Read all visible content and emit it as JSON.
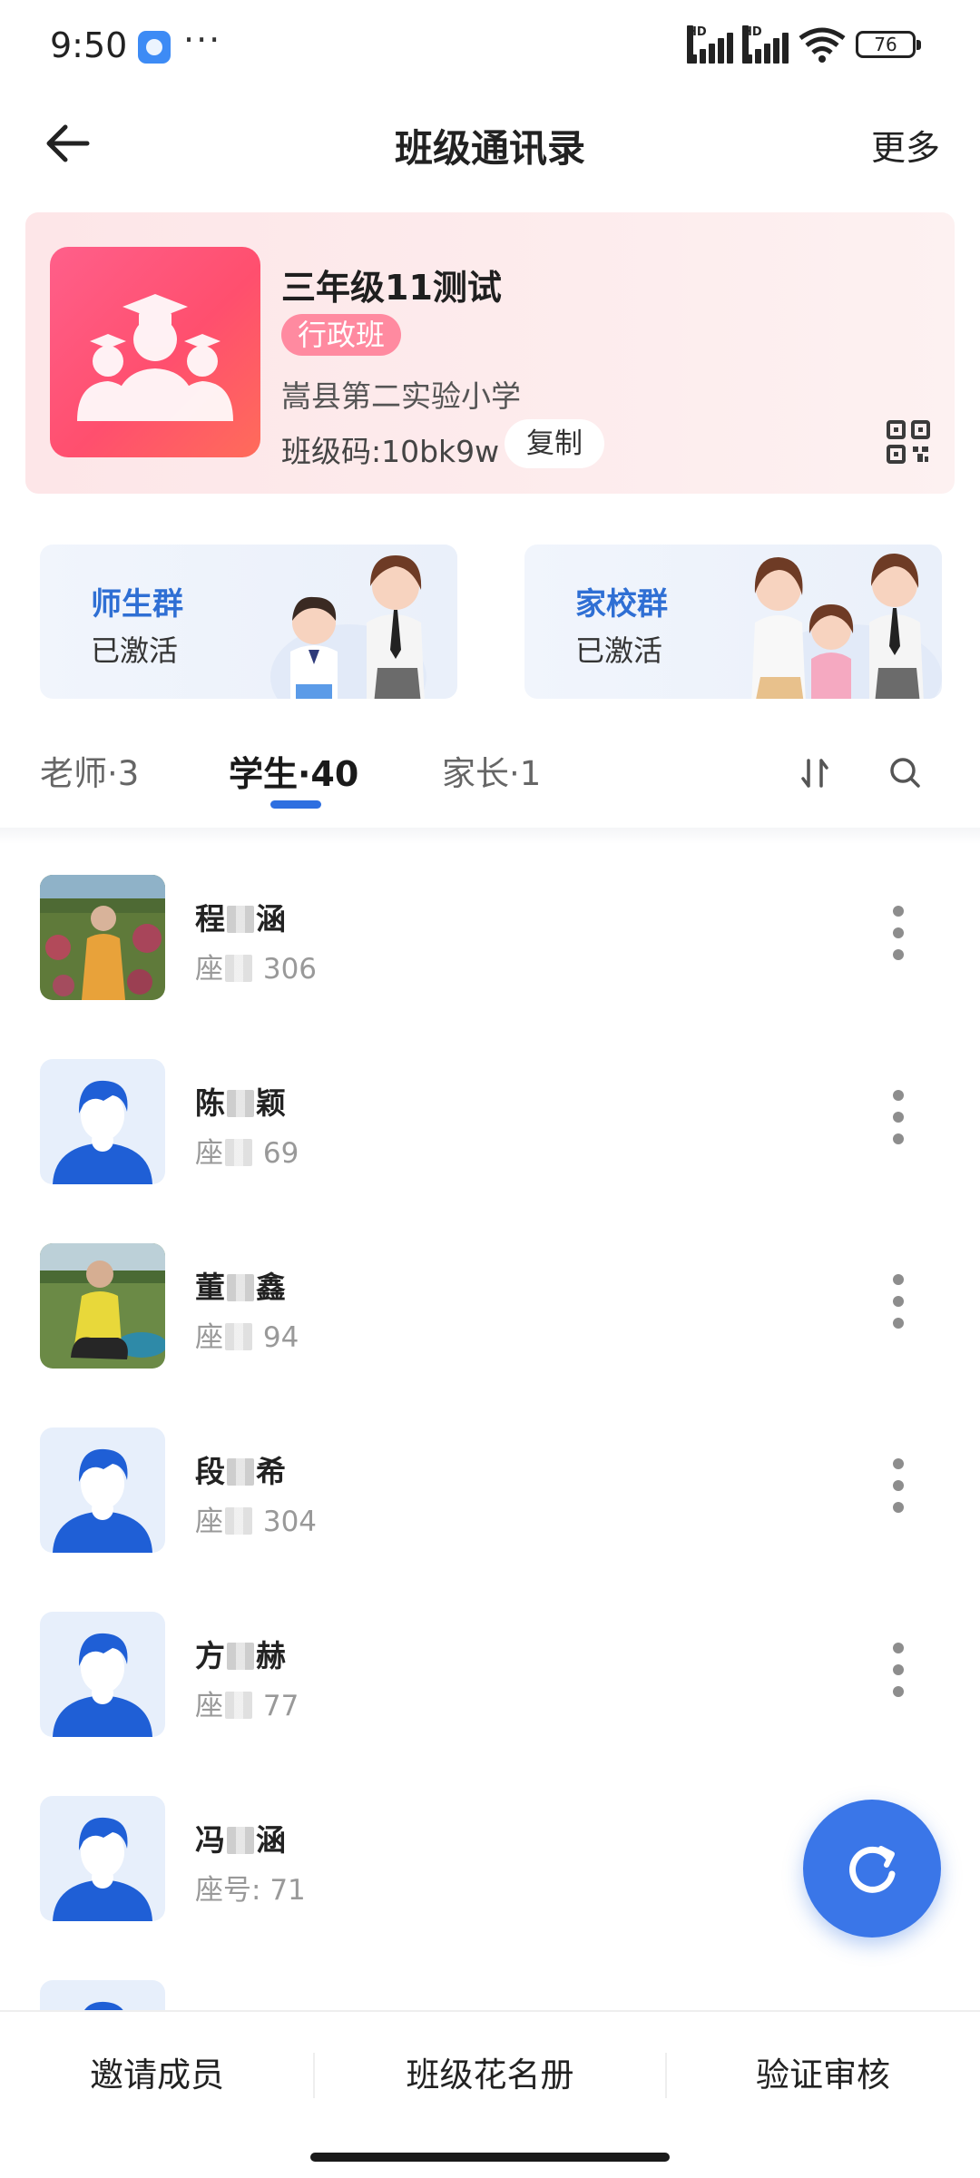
{
  "status_bar": {
    "time": "9:50",
    "more": "···",
    "signal_labels": [
      "HD",
      "HD"
    ],
    "battery": "76"
  },
  "header": {
    "title": "班级通讯录",
    "more": "更多"
  },
  "class_card": {
    "name": "三年级11测试",
    "tag": "行政班",
    "school": "嵩县第二实验小学",
    "code": "班级码:10bk9w",
    "copy": "复制"
  },
  "groups": [
    {
      "title": "师生群",
      "status": "已激活"
    },
    {
      "title": "家校群",
      "status": "已激活"
    }
  ],
  "tabs": [
    {
      "label": "老师·3"
    },
    {
      "label": "学生·40"
    },
    {
      "label": "家长·1"
    }
  ],
  "students": [
    {
      "surname": "程",
      "given_end": "涵",
      "seat_prefix": "座",
      "seat_value": "306",
      "avatar": "photo"
    },
    {
      "surname": "陈",
      "given_end": "颖",
      "seat_prefix": "座",
      "seat_value": "69",
      "avatar": "default"
    },
    {
      "surname": "董",
      "given_end": "鑫",
      "seat_prefix": "座",
      "seat_value": "94",
      "avatar": "photo"
    },
    {
      "surname": "段",
      "given_end": "希",
      "seat_prefix": "座",
      "seat_value": "304",
      "avatar": "default"
    },
    {
      "surname": "方",
      "given_end": "赫",
      "seat_prefix": "座",
      "seat_value": "77",
      "avatar": "default"
    },
    {
      "surname": "冯",
      "given_end": "涵",
      "seat_prefix": "座号:",
      "seat_value": "71",
      "avatar": "default"
    }
  ],
  "bottom_bar": {
    "invite": "邀请成员",
    "roster": "班级花名册",
    "verify": "验证审核"
  },
  "colors": {
    "accent": "#2e6fe0",
    "tag": "#ff8aa0",
    "card_bg": "#fde6e8"
  }
}
